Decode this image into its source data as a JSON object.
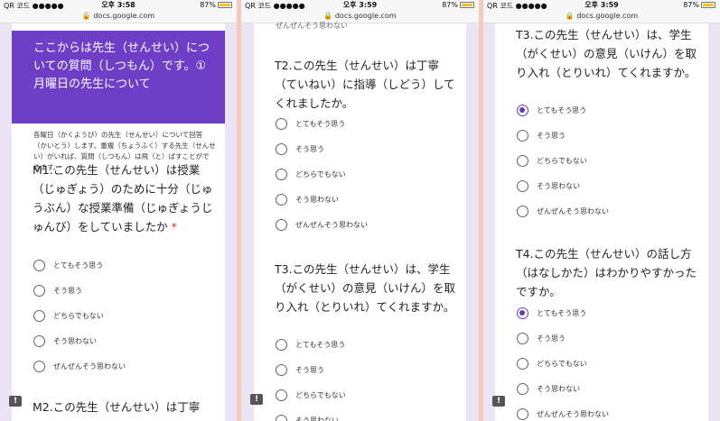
{
  "status_bars": [
    {
      "carrier": "QR 코드 ●●●●●",
      "time": "오후 3:58",
      "battery": "87%",
      "url": "docs.google.com"
    },
    {
      "carrier": "QR 코드 ●●●●●",
      "time": "오후 3:59",
      "battery": "87%",
      "url": "docs.google.com"
    },
    {
      "carrier": "QR 코드 ●●●●●",
      "time": "오후 3:59",
      "battery": "87%",
      "url": "docs.google.com"
    }
  ],
  "panel1": {
    "section_header": "ここからは先生（せんせい）についての質問（しつもん）です。①月曜日の先生について",
    "description": "各曜日（かくようび）の先生（せんせい）について回答（かいとう）します。重複（ちょうふく）する先生（せんせい）がいれば、質問（しつもん）は飛（と）ばすことができます。",
    "q1_title": "M1.この先生（せんせい）は授業（じゅぎょう）のために十分（じゅうぶん）な授業準備（じゅぎょうじゅんび）をしていましたか",
    "q1_required": "*",
    "q2_title": "M2.この先生（せんせい）は丁寧"
  },
  "panel2": {
    "top_partial": "ぜんぜんそう思わない",
    "q_t2_title": "T2.この先生（せんせい）は丁寧（ていねい）に指導（しどう）してくれましたか。",
    "q_t3_title": "T3.この先生（せんせい）は、学生（がくせい）の意見（いけん）を取り入れ（とりいれ）てくれますか。"
  },
  "panel3": {
    "q_t3_title": "T3.この先生（せんせい）は、学生（がくせい）の意見（いけん）を取り入れ（とりいれ）てくれますか。",
    "q_t4_title": "T4.この先生（せんせい）の話し方（はなしかた）はわかりやすかったですか。"
  },
  "options": [
    "とてもそう思う",
    "そう思う",
    "どちらでもない",
    "そう思わない",
    "ぜんぜんそう思わない"
  ],
  "feedback_icon": "!",
  "colors": {
    "accent": "#673ab7",
    "header": "#6e3ec7",
    "background": "#ebe4f4"
  }
}
